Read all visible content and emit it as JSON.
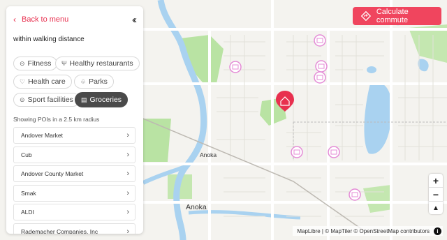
{
  "colors": {
    "accent": "#f0455e",
    "back_link": "#e8304f",
    "active_chip": "#4a4a4a",
    "water": "#a9d2f0",
    "park": "#b6e29c",
    "poi_marker": "#e48bd6",
    "home_marker": "#e8304f"
  },
  "panel": {
    "back_label": "Back to menu",
    "collapse_icon": "double-chevron-left",
    "intro_text": "within walking distance",
    "categories": [
      {
        "label": "Fitness",
        "icon": "dumbbell-icon",
        "active": false
      },
      {
        "label": "Healthy restaurants",
        "icon": "cutlery-icon",
        "active": false
      },
      {
        "label": "Health care",
        "icon": "heart-icon",
        "active": false
      },
      {
        "label": "Parks",
        "icon": "tree-icon",
        "active": false
      },
      {
        "label": "Sport facilities",
        "icon": "dumbbell-icon",
        "active": false
      },
      {
        "label": "Groceries",
        "icon": "store-icon",
        "active": true
      }
    ],
    "radius_note": "Showing POIs in a 2.5 km radius",
    "pois": [
      {
        "name": "Andover Market"
      },
      {
        "name": "Cub"
      },
      {
        "name": "Andover County Market"
      },
      {
        "name": "Smak"
      },
      {
        "name": "ALDI"
      },
      {
        "name": "Rademacher Companies, Inc"
      }
    ]
  },
  "commute_button": {
    "label": "Calculate commute",
    "icon": "route-icon"
  },
  "map": {
    "labels": {
      "small_town": "Anoka",
      "large_town": "Anoka"
    },
    "zoom_in": "+",
    "zoom_out": "−",
    "compass": "▲"
  },
  "attribution": "MapLibre | © MapTiler © OpenStreetMap contributors"
}
